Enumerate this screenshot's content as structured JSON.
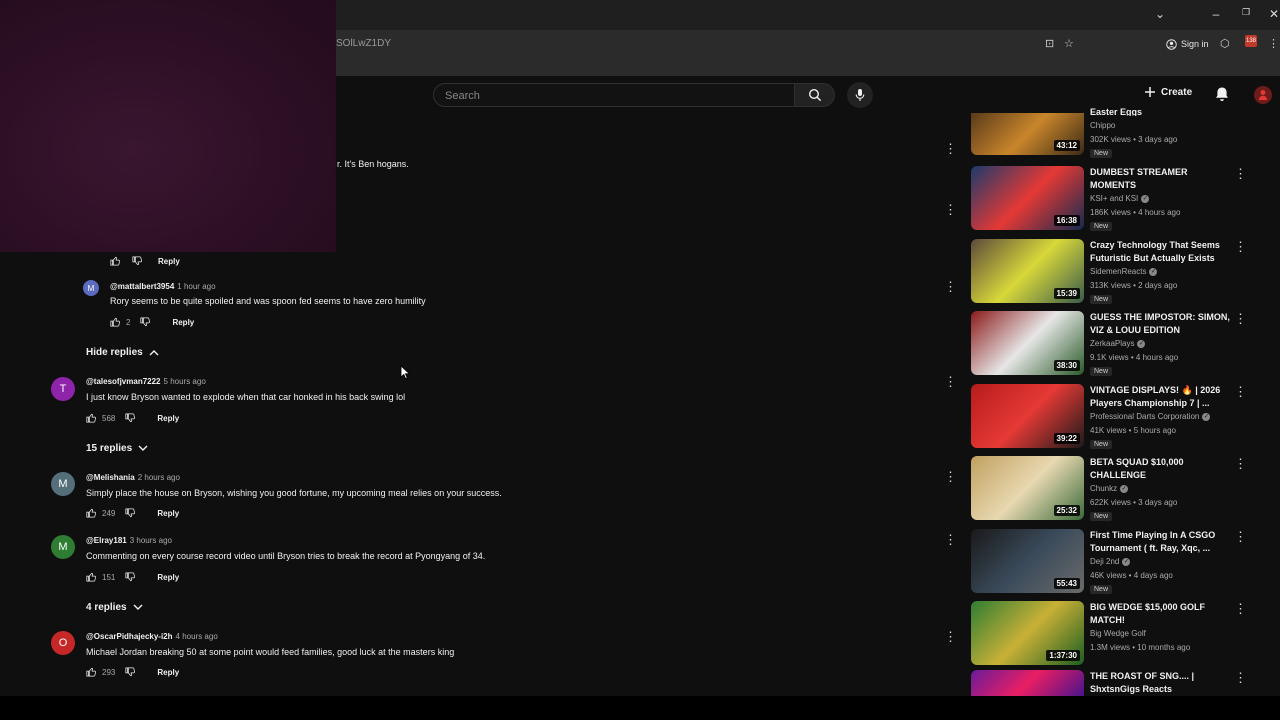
{
  "browser": {
    "url_fragment": "SOlLwZ1DY",
    "signin_label": "Sign in",
    "ext_badge": "138"
  },
  "header": {
    "search_placeholder": "Search",
    "create_label": "Create"
  },
  "partial_comment": "r. It's Ben hogans.",
  "replies": [
    {
      "actions_only": true,
      "reply_label": "Reply"
    },
    {
      "author": "@mattalbert3954",
      "avatar_letter": "M",
      "avatar_color": "#5c6bc0",
      "time": "1 hour ago",
      "text": "Rory seems to be quite spoiled and was spoon fed seems to have zero humility",
      "likes": "2",
      "reply_label": "Reply"
    }
  ],
  "hide_replies_label": "Hide replies",
  "comments": [
    {
      "author": "@talesofjvman7222",
      "avatar_letter": "T",
      "avatar_color": "#8e24aa",
      "time": "5 hours ago",
      "text": "I just know Bryson wanted to explode when that car honked in his back swing lol",
      "likes": "568",
      "reply_label": "Reply",
      "replies_toggle": "15 replies"
    },
    {
      "author": "@Melishania",
      "avatar_letter": "M",
      "avatar_color": "#546e7a",
      "time": "2 hours ago",
      "text": "Simply place the house on Bryson, wishing you good fortune, my upcoming meal relies on your success.",
      "likes": "249",
      "reply_label": "Reply"
    },
    {
      "author": "@Elray181",
      "avatar_letter": "M",
      "avatar_color": "#2e7d32",
      "time": "3 hours ago",
      "text": "Commenting on every course record video until Bryson tries to break the record at Pyongyang of 34.",
      "likes": "151",
      "reply_label": "Reply",
      "replies_toggle": "4 replies"
    },
    {
      "author": "@OscarPidhajecky-i2h",
      "avatar_letter": "O",
      "avatar_color": "#c62828",
      "time": "4 hours ago",
      "text": "Michael Jordan breaking 50 at some point would feed families, good luck at the masters king",
      "likes": "293",
      "reply_label": "Reply"
    }
  ],
  "sidebar": [
    {
      "title": "Easter Eggs",
      "channel": "Chippo",
      "verified": false,
      "meta": "302K views • 3 days ago",
      "badge": "New",
      "duration": "43:12",
      "thumb_colors": [
        "#5a3a1a",
        "#c9862b",
        "#3b2a16"
      ]
    },
    {
      "title": "DUMBEST STREAMER MOMENTS",
      "channel": "KSI+ and KSI",
      "verified": true,
      "meta": "186K views • 4 hours ago",
      "badge": "New",
      "duration": "16:38",
      "thumb_colors": [
        "#1b3a6b",
        "#e53935",
        "#122a4f"
      ]
    },
    {
      "title": "Crazy Technology That Seems Futuristic But Actually Exists",
      "channel": "SidemenReacts",
      "verified": true,
      "meta": "313K views • 2 days ago",
      "badge": "New",
      "duration": "15:39",
      "thumb_colors": [
        "#5d4a3a",
        "#d8d83a",
        "#3a5a4a"
      ]
    },
    {
      "title": "GUESS THE IMPOSTOR: SIMON, VIZ & LOUU EDITION",
      "channel": "ZerkaaPlays",
      "verified": true,
      "meta": "9.1K views • 4 hours ago",
      "badge": "New",
      "duration": "38:30",
      "thumb_colors": [
        "#8b1a1a",
        "#e6e6e6",
        "#2a5a2a"
      ]
    },
    {
      "title": "VINTAGE DISPLAYS! 🔥 | 2026 Players Championship 7 | ...",
      "channel": "Professional Darts Corporation",
      "verified": true,
      "meta": "41K views • 5 hours ago",
      "badge": "New",
      "duration": "39:22",
      "thumb_colors": [
        "#b71c1c",
        "#e53935",
        "#1a1a1a"
      ]
    },
    {
      "title": "BETA SQUAD $10,000 CHALLENGE",
      "channel": "Chunkz",
      "verified": true,
      "meta": "622K views • 3 days ago",
      "badge": "New",
      "duration": "25:32",
      "thumb_colors": [
        "#c0a060",
        "#e8d8b0",
        "#3a6a3a"
      ]
    },
    {
      "title": "First Time Playing In A CSGO Tournament ( ft. Ray, Xqc, ...",
      "channel": "Deji 2nd",
      "verified": true,
      "meta": "46K views • 4 days ago",
      "badge": "New",
      "duration": "55:43",
      "thumb_colors": [
        "#1a1a1a",
        "#3a4a5a",
        "#6a6a6a"
      ]
    },
    {
      "title": "BIG WEDGE $15,000 GOLF MATCH!",
      "channel": "Big Wedge Golf",
      "verified": false,
      "meta": "1.3M views • 10 months ago",
      "badge": "",
      "duration": "1:37:30",
      "thumb_colors": [
        "#2e7d32",
        "#c9b037",
        "#1b5e20"
      ]
    },
    {
      "title": "THE ROAST OF SNG.... | ShxtsnGigs Reacts",
      "channel": "",
      "verified": false,
      "meta": "",
      "badge": "",
      "duration": "",
      "thumb_colors": [
        "#6a1b9a",
        "#e91e63",
        "#4a148c"
      ]
    }
  ]
}
